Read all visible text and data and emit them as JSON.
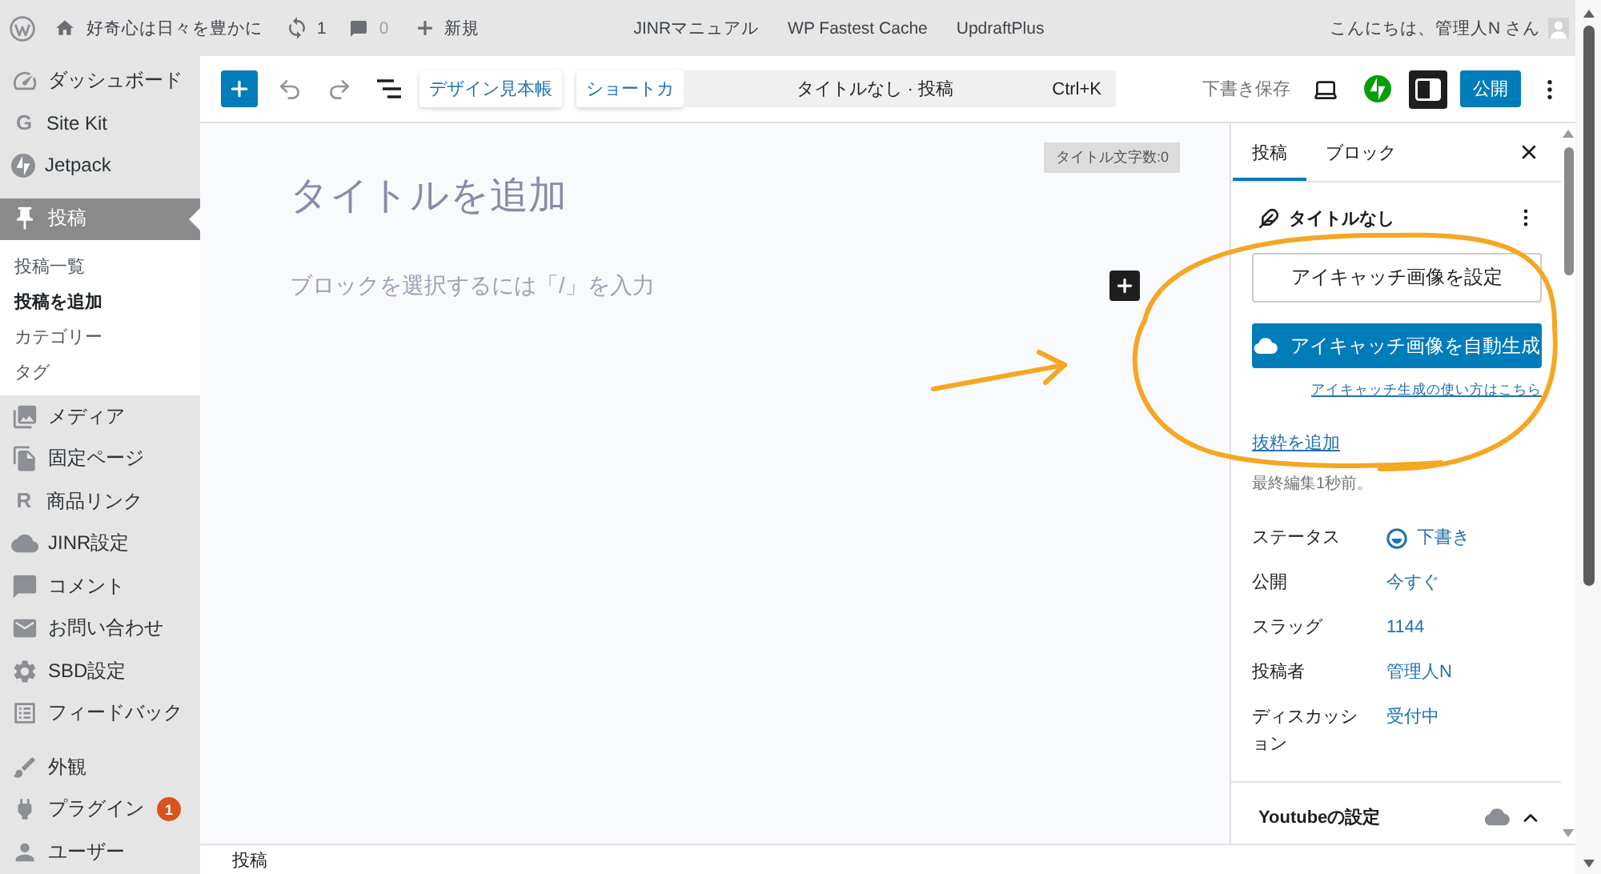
{
  "admin_bar": {
    "site_name": "好奇心は日々を豊かに",
    "updates": "1",
    "comments": "0",
    "new_label": "新規",
    "links": [
      "JINRマニュアル",
      "WP Fastest Cache",
      "UpdraftPlus"
    ],
    "greeting": "こんにちは、管理人N さん"
  },
  "sidebar": {
    "groups": [
      {
        "items": [
          {
            "label": "ダッシュボード",
            "selected": false
          },
          {
            "label": "Site Kit",
            "glyph": "G",
            "selected": false
          },
          {
            "label": "Jetpack",
            "selected": false
          }
        ]
      },
      {
        "items": [
          {
            "label": "投稿",
            "selected": true,
            "children": [
              {
                "label": "投稿一覧",
                "selected": false
              },
              {
                "label": "投稿を追加",
                "selected": true
              },
              {
                "label": "カテゴリー",
                "selected": false
              },
              {
                "label": "タグ",
                "selected": false
              }
            ]
          },
          {
            "label": "メディア",
            "selected": false
          },
          {
            "label": "固定ページ",
            "selected": false
          },
          {
            "label": "商品リンク",
            "glyph": "R",
            "selected": false
          },
          {
            "label": "JINR設定",
            "selected": false
          },
          {
            "label": "コメント",
            "selected": false
          },
          {
            "label": "お問い合わせ",
            "selected": false
          },
          {
            "label": "SBD設定",
            "selected": false
          },
          {
            "label": "フィードバック",
            "selected": false
          }
        ]
      },
      {
        "items": [
          {
            "label": "外観",
            "selected": false
          },
          {
            "label": "プラグイン",
            "badge": "1",
            "selected": false
          },
          {
            "label": "ユーザー",
            "selected": false
          }
        ]
      }
    ]
  },
  "toolbar": {
    "tool_buttons": [
      "デザイン見本帳",
      "ショートカ"
    ],
    "command_title": "タイトルなし · 投稿",
    "command_shortcut": "Ctrl+K",
    "save_draft": "下書き保存",
    "settings_pressed": true,
    "publish": "公開"
  },
  "editor": {
    "title_count": "タイトル文字数:0",
    "title_field": {
      "placeholder": "タイトルを追加"
    },
    "block_field": {
      "placeholder": "ブロックを選択するには「/」を入力"
    }
  },
  "panel": {
    "tabs": [
      {
        "label": "投稿",
        "selected": true
      },
      {
        "label": "ブロック",
        "selected": false
      }
    ],
    "post_title": "タイトルなし",
    "featured_button": "アイキャッチ画像を設定",
    "auto_button": "アイキャッチ画像を自動生成",
    "help_link": "アイキャッチ生成の使い方はこちら",
    "excerpt_link": "抜粋を追加",
    "last_edited": "最終編集1秒前。",
    "fields": [
      {
        "kind": "status",
        "label": "ステータス",
        "value": "下書き"
      },
      {
        "kind": "link",
        "label": "公開",
        "value": "今すぐ"
      },
      {
        "kind": "link",
        "label": "スラッグ",
        "value": "1144"
      },
      {
        "kind": "link",
        "label": "投稿者",
        "value": "管理人N"
      },
      {
        "kind": "link",
        "label": "ディスカッション",
        "value": "受付中"
      }
    ],
    "sections": [
      {
        "title": "Youtubeの設定",
        "expanded": true
      }
    ]
  },
  "footer": {
    "breadcrumb": "投稿"
  },
  "annotations": [
    {
      "kind": "arrow"
    },
    {
      "kind": "loop"
    }
  ]
}
